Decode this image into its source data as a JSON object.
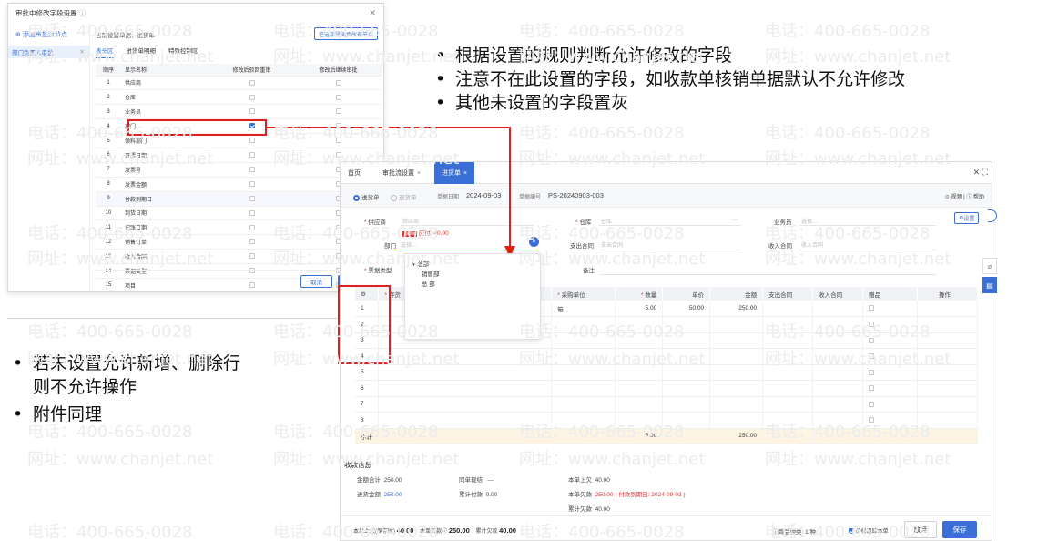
{
  "watermark": {
    "phone": "电话：400-665-0028",
    "site": "网址：www.chanjet.net"
  },
  "dialog": {
    "title": "审批中修改字段设置",
    "add_node": "添加审批流节点",
    "node_item": "部门负责人审批",
    "current_node": "当前设置单据：进货单",
    "select_fields_btn": "已选字段同步所有节点",
    "tabs": [
      "表头区",
      "进货单明细",
      "特殊控制区"
    ],
    "columns": [
      "顺序",
      "显示名称",
      "修改后驳回重审",
      "修改后继续审批"
    ],
    "rows": [
      {
        "no": "1",
        "name": "供应商",
        "a": false,
        "b": false
      },
      {
        "no": "2",
        "name": "仓库",
        "a": false,
        "b": false
      },
      {
        "no": "3",
        "name": "业务员",
        "a": false,
        "b": false
      },
      {
        "no": "4",
        "name": "部门",
        "a": true,
        "b": false
      },
      {
        "no": "5",
        "name": "领料部门",
        "a": false,
        "b": false
      },
      {
        "no": "6",
        "name": "开票日期",
        "a": false,
        "b": false
      },
      {
        "no": "7",
        "name": "发票号",
        "a": false,
        "b": false
      },
      {
        "no": "8",
        "name": "发票金额",
        "a": false,
        "b": false
      },
      {
        "no": "9",
        "name": "付款到期日",
        "a": false,
        "b": false
      },
      {
        "no": "10",
        "name": "到货日期",
        "a": false,
        "b": false
      },
      {
        "no": "11",
        "name": "记账日期",
        "a": false,
        "b": false
      },
      {
        "no": "12",
        "name": "销售订单",
        "a": false,
        "b": false
      },
      {
        "no": "13",
        "name": "收入合同",
        "a": false,
        "b": false
      },
      {
        "no": "14",
        "name": "票据类型",
        "a": false,
        "b": false
      },
      {
        "no": "15",
        "name": "项目",
        "a": false,
        "b": false
      }
    ],
    "cancel": "取消"
  },
  "bullets_top": [
    "根据设置的规则判断允许修改的字段",
    "注意不在此设置的字段，如收款单核销单据默认不允许修改",
    "其他未设置的字段置灰"
  ],
  "bullets_left": [
    "若未设置允许新增、删除行",
    "则不允许操作",
    "附件同理"
  ],
  "app": {
    "tabs": [
      "首页",
      "审批流设置",
      "进货单"
    ],
    "radio_purchase": "进货单",
    "radio_return": "退货单",
    "date_label": "单据日期",
    "date_value": "2024-09-03",
    "no_label": "单据编号",
    "no_value": "PS-20240903-003",
    "video_help": "视频 | ⓘ 帮助",
    "supplier_label": "供应商",
    "supplier_ph": "供应商",
    "supplier_tag": "现结",
    "supplier_due": "应付: 40.00",
    "warehouse_label": "仓库",
    "warehouse_ph": "仓库",
    "sales_label": "业务员",
    "sales_ph": "选择...",
    "settings_btn": "设置",
    "dept_label": "部门",
    "dept_ph": "选择...",
    "pay_contract_label": "支出合同",
    "pay_contract_ph": "支出合同",
    "income_contract_label": "收入合同",
    "income_contract_ph": "收入合同",
    "bill_type_label": "票据类型",
    "remark_label": "备注",
    "dept_dropdown": [
      "总部",
      "销售部",
      "总 部"
    ],
    "grid_columns": [
      "",
      "存货",
      "采购单位",
      "数量",
      "单价",
      "金额",
      "支出合同",
      "收入合同",
      "赠品",
      "操作"
    ],
    "grid_rows": [
      {
        "no": "1",
        "unit": "箱",
        "qty": "5.00",
        "price": "50.00",
        "amount": "250.00"
      },
      {
        "no": "2"
      },
      {
        "no": "3"
      },
      {
        "no": "4"
      },
      {
        "no": "5"
      },
      {
        "no": "6"
      },
      {
        "no": "7"
      },
      {
        "no": "8"
      }
    ],
    "subtotal_label": "小计",
    "subtotal_qty": "5.00",
    "subtotal_amount": "250.00",
    "pay_title": "收款信息",
    "amount_total_label": "金额合计",
    "amount_total": "250.00",
    "purchase_amount_label": "进货金额",
    "purchase_amount": "250.00",
    "same_spec_label": "同单现结",
    "same_spec": "---",
    "cumulative_pay_label": "累计付款",
    "cumulative_pay": "0.00",
    "prev_owe_label": "本单上欠",
    "prev_owe": "40.00",
    "cur_owe_label": "本单欠款",
    "cur_owe": "250.00",
    "cur_owe_note": "( 付款到期日: 2024-09-03 )",
    "total_owe_label": "累计欠款",
    "total_owe": "40.00",
    "footer_prev_label": "本单上欠(保存时)",
    "footer_prev": "40.00",
    "footer_owe_label": "本单欠款",
    "footer_owe": "250.00",
    "footer_total_label": "累计欠款",
    "footer_total": "40.00",
    "goods_kinds": "商品种类: 1 种",
    "trace_label": "价格追踪本单",
    "btn_give_up": "放弃",
    "btn_save": "保存"
  }
}
